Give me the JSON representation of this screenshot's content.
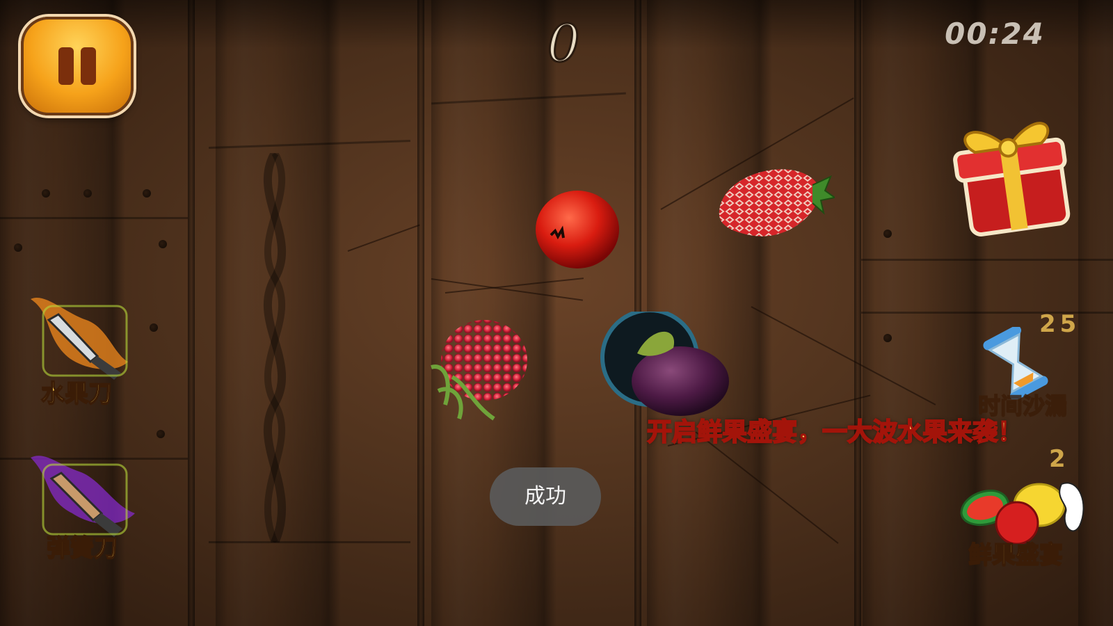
{
  "hud": {
    "score": "0",
    "timer": "00:24"
  },
  "powerups": {
    "fruit_knife": {
      "label": "水果刀",
      "icon": "flaming-knife-icon"
    },
    "spring_knife": {
      "label": "弹簧刀",
      "icon": "lightning-knife-icon"
    },
    "hourglass": {
      "label": "时间沙漏",
      "count": "25",
      "icon": "hourglass-icon"
    },
    "fruit_feast": {
      "label": "鲜果盛宴",
      "count": "2",
      "icon": "fruit-bundle-icon"
    }
  },
  "banner": {
    "text": "开启鲜果盛宴，一大波水果来袭！"
  },
  "toast": {
    "text": "成功"
  },
  "fruits": [
    "apple",
    "strawberry",
    "raspberry",
    "plum"
  ],
  "colors": {
    "wood": "#4f321d",
    "pause_button": "#f6a21a",
    "label_gold": "#f2c64c",
    "banner_fill": "#ffe56a",
    "banner_stroke": "#a3140a"
  }
}
